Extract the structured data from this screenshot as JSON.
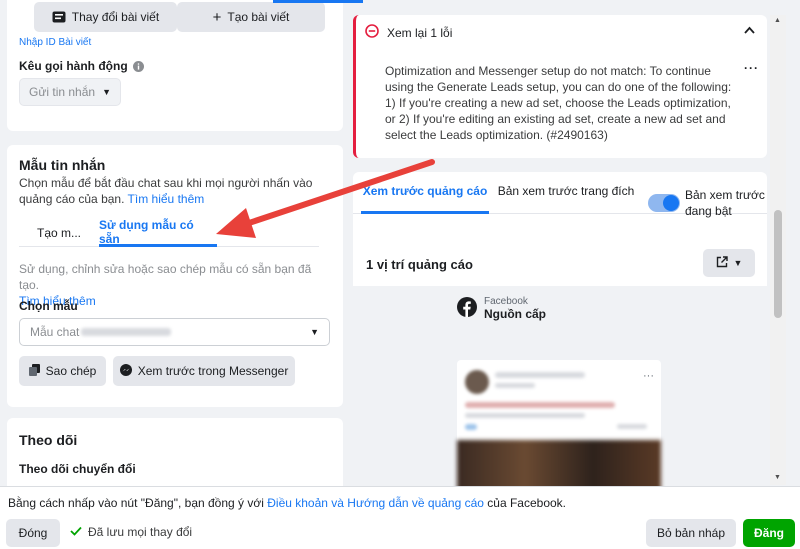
{
  "top_card": {
    "change_post_label": "Thay đổi bài viết",
    "create_post_label": "Tạo bài viết",
    "enter_id_link": "Nhập ID Bài viết",
    "cta_title": "Kêu gọi hành động",
    "cta_value": "Gửi tin nhắn"
  },
  "template_card": {
    "title": "Mẫu tin nhắn",
    "description": "Chọn mẫu để bắt đầu chat sau khi mọi người nhấn vào quảng cáo của bạn.",
    "learn_more": "Tìm hiểu thêm",
    "tabs": [
      {
        "label": "Tạo m..."
      },
      {
        "label": "Sử dụng mẫu có sẵn"
      }
    ],
    "hint": "Sử dụng, chỉnh sửa hoặc sao chép mẫu có sẵn bạn đã tạo.",
    "hint_link": "Tìm hiểu thêm",
    "choose_label": "Chọn mẫu",
    "template_value": "Mẫu chat",
    "copy_button": "Sao chép",
    "messenger_preview_button": "Xem trước trong Messenger"
  },
  "tracking_card": {
    "title": "Theo dõi",
    "conversion_title": "Theo dõi chuyển đổi"
  },
  "error_box": {
    "title": "Xem lại 1 lỗi",
    "message": "Optimization and Messenger setup do not match: To continue using the Generate Leads setup, you can do one of the following: 1) If you're creating a new ad set, choose the Leads optimization, or 2) If you're editing an existing ad set, create a new ad set and select the Leads optimization. (#2490163)"
  },
  "preview": {
    "tabs": [
      {
        "label": "Xem trước quảng cáo"
      },
      {
        "label": "Bản xem trước trang đích"
      }
    ],
    "toggle_label": "Bản xem trước đang bật",
    "toggle_on": true,
    "placements_title": "1 vị trí quảng cáo",
    "platform": "Facebook",
    "placement": "Nguồn cấp"
  },
  "footer": {
    "terms_prefix": "Bằng cách nhấp vào nút \"Đăng\", bạn đồng ý với ",
    "terms_link": "Điều khoản và Hướng dẫn về quảng cáo",
    "terms_suffix": " của Facebook.",
    "close_button": "Đóng",
    "saved_status": "Đã lưu mọi thay đổi",
    "discard_button": "Bỏ bản nháp",
    "publish_button": "Đăng"
  },
  "colors": {
    "accent": "#1877f2",
    "error": "#e41e3f",
    "publish": "#00a400",
    "arrow": "#e8413a"
  }
}
